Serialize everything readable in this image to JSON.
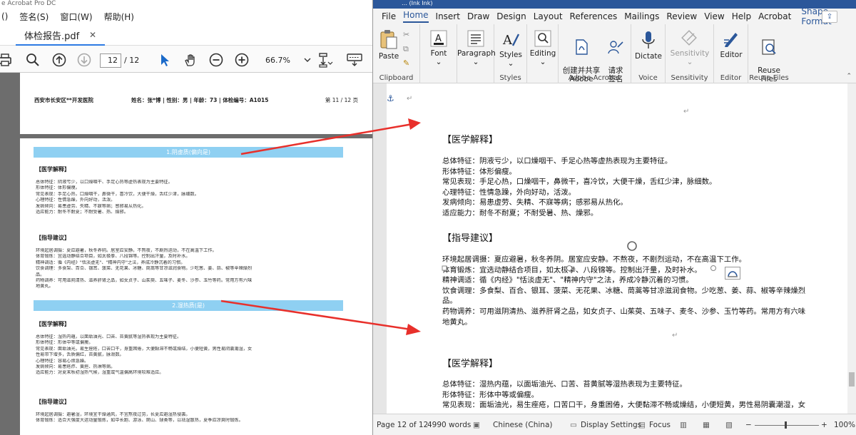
{
  "acrobat": {
    "title": "e Acrobat Pro DC",
    "menu": [
      "()",
      "签名(S)",
      "窗口(W)",
      "帮助(H)"
    ],
    "tab_label": "体检报告.pdf",
    "tab_close": "✕",
    "page_current": "12",
    "page_total": "/ 12",
    "zoom": "66.7%",
    "page_header": {
      "left": "西安市长安区**开发医院",
      "mid": "姓名：张*博 | 性别：男 | 年龄：73 | 体检编号：A1015",
      "right": "第 11 / 12 页"
    },
    "band1": "1.阴虚质(偏向是)",
    "band2": "2.湿热质(是)",
    "h_explain": "【医学解释】",
    "h_advice": "【指导建议】",
    "explain1": [
      "总体特征：阴液亏少，以口燥咽干、手足心热等虚热表现为主要特征。",
      "形体特征：体形偏瘦。",
      "常见表现：手足心热，口燥咽干，鼻微干，喜冷饮，大便干燥，舌红少津，脉细数。",
      "心理特征：性情急躁，外向好动，活泼。",
      "发病倾向：易患虚劳、失精、不寐等病；感邪易从热化。",
      "适应能力：耐冬不耐夏；不耐受暑、热、燥邪。"
    ],
    "advice1": [
      "环境起居调摄：夏应避暑，秋冬养阴。居室应安静。不熬夜，不剧烈运动，不在高温下工作。",
      "体育锻炼：宜选动静结合项目，如太极拳、八段锦等。控制出汗量，及时补水。",
      "精神调适：循《内经》\"恬淡虚无\"、\"精神内守\"之法，养成冷静沉着的习惯。",
      "饮食调理：多食梨、百合、银耳、菠菜、无花果、冰糖、茼蒿等甘凉滋润食物。少吃葱、姜、蒜、椒等辛辣燥烈",
      "品。",
      "药物调养：可用滋阴清热、滋养肝肾之品，如女贞子、山茱萸、五味子、麦冬、沙参、玉竹等药。常用方有六味",
      "地黄丸。"
    ],
    "explain2": [
      "总体特征：湿热内蕴，以面垢油光、口苦、苔黄腻等湿热表现为主要特征。",
      "形体特征：形体中等或偏瘦。",
      "常见表现：面垢油光，易生痤疮，口苦口干，身重困倦，大便黏滞不畅或燥结，小便短黄，男性易阴囊潮湿，女",
      "性易带下增多，舌质偏红，苔黄腻，脉滑数。",
      "心理特征：容易心烦急躁。",
      "发病倾向：易患疮疖、黄疸、热淋等病。",
      "适应能力：对夏末秋初湿热气候，湿重或气温偏高环境较难适应。"
    ],
    "advice2": [
      "环境起居调摄：避暑湿，环境宜干燥通风，不宜熬夜过劳，长夏应避湿热侵袭。",
      "体育锻炼：适合大强度大运动量锻炼，如中长跑、游泳、爬山、球类等，以祛湿散热，夏季应凉爽时锻炼。"
    ]
  },
  "word": {
    "titlebar": "  …                                                                    (Ink Ink)",
    "menu": [
      "File",
      "Home",
      "Insert",
      "Draw",
      "Design",
      "Layout",
      "References",
      "Mailings",
      "Review",
      "View",
      "Help",
      "Acrobat"
    ],
    "menu_shape": "Shape Format",
    "ribbon": {
      "paste": "Paste",
      "clipboard": "Clipboard",
      "font": "Font",
      "paragraph": "Paragraph",
      "styles_btn": "Styles",
      "styles": "Styles",
      "editing": "Editing",
      "create_pdf": "创建并共享\nAdobe PDF",
      "request_sign": "请求\n签名",
      "adobe_acrobat": "Adobe Acrobat",
      "dictate": "Dictate",
      "voice": "Voice",
      "sensitivity_btn": "Sensitivity",
      "sensitivity": "Sensitivity",
      "editor_btn": "Editor",
      "editor": "Editor",
      "reuse_btn": "Reuse\nFiles",
      "reuse": "Reuse Files"
    },
    "doc": {
      "h_explain": "【医学解释】",
      "h_advice": "【指导建议】",
      "explain1": [
        "总体特征：阴液亏少，以口燥咽干、手足心热等虚热表现为主要特征。",
        "形体特征：体形偏瘦。",
        "常见表现：手足心热，口燥咽干，鼻微干，喜冷饮，大便干燥，舌红少津，脉细数。",
        "心理特征：性情急躁，外向好动，活泼。",
        "发病倾向：易患虚劳、失精、不寐等病；感邪易从热化。",
        "适应能力：耐冬不耐夏；不耐受暑、热、燥邪。"
      ],
      "advice1": [
        "环境起居调摄：夏应避暑，秋冬养阴。居室应安静。不熬夜，不剧烈运动，不在高温下工作。",
        "体育锻炼：宜选动静结合项目，如太极拳、八段锦等。控制出汗量，及时补水。",
        "精神调适：循《内经》\"恬淡虚无\"、\"精神内守\"之法，养成冷静沉着的习惯。",
        "饮食调理：多食梨、百合、银耳、菠菜、无花果、冰糖、茼蒿等甘凉滋润食物。少吃葱、姜、蒜、椒等辛辣燥烈",
        "品。",
        "药物调养：可用滋阴清热、滋养肝肾之品，如女贞子、山茱萸、五味子、麦冬、沙参、玉竹等药。常用方有六味",
        "地黄丸。"
      ],
      "explain2": [
        "总体特征：湿热内蕴，以面垢油光、口苦、苔黄腻等湿热表现为主要特征。",
        "形体特征：形体中等或偏瘦。",
        "常见表现：面垢油光，易生痤疮，口苦口干，身重困倦，大便黏滞不畅或燥结，小便短黄，男性易阴囊潮湿，女"
      ]
    },
    "status": {
      "page": "Page 12 of 12",
      "words": "4990 words",
      "language": "Chinese (China)",
      "display": "Display Settings",
      "focus": "Focus",
      "zoom": "100%"
    }
  },
  "colors": {
    "word_blue": "#2b579a",
    "band": "#8fd0f2",
    "arrow": "#e8302b"
  }
}
